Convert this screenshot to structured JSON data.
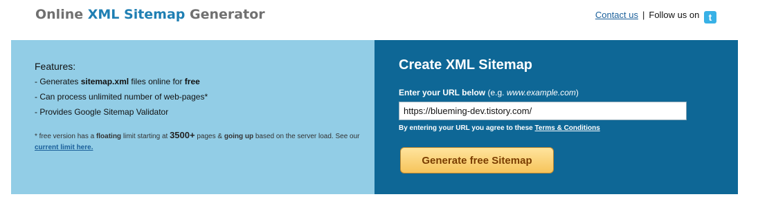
{
  "header": {
    "logo": {
      "part1": "Online ",
      "part2": "XML Sitemap",
      "part3": " Generator"
    },
    "contact_link": "Contact us",
    "separator": "|",
    "follow_text": "Follow us on",
    "twitter_icon": "twitter-icon"
  },
  "features": {
    "title": "Features:",
    "item1": {
      "prefix": "- Generates ",
      "bold1": "sitemap.xml",
      "middle": " files online for ",
      "bold2": "free"
    },
    "item2": "- Can process unlimited number of web-pages*",
    "item3": "- Provides Google Sitemap Validator",
    "footnote": {
      "part1": "* free version has a ",
      "floating": "floating",
      "part2": " limit starting at ",
      "pages_number": "3500+",
      "part3": " pages & ",
      "going_up": "going up",
      "part4": " based on the server load. See our ",
      "link": "current limit here."
    }
  },
  "form": {
    "title": "Create XML Sitemap",
    "label_bold": "Enter your URL below",
    "label_hint_prefix": " (e.g. ",
    "label_hint_example": "www.example.com",
    "label_hint_suffix": ")",
    "url_value": "https://blueming-dev.tistory.com/",
    "agree_text": "By entering your URL you agree to these ",
    "terms_link": "Terms & Conditions",
    "button_label": "Generate free Sitemap"
  },
  "colors": {
    "left_panel": "#92cde6",
    "right_panel": "#0e6796",
    "button": "#f6c45b",
    "logo_accent": "#1f7fb3"
  }
}
